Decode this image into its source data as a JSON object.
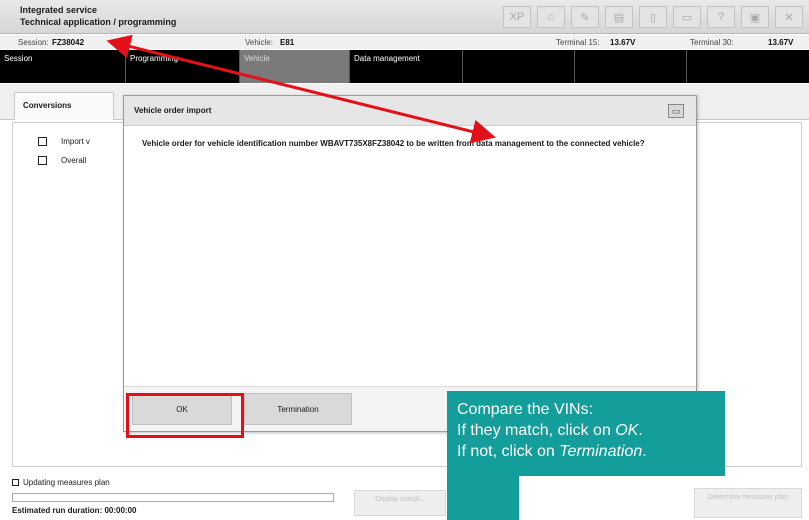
{
  "app": {
    "title_line1": "Integrated service",
    "title_line2": "Technical application / programming",
    "toolbar_icons": [
      "xp-icon",
      "home-icon",
      "wrench-icon",
      "id-card-icon",
      "document-icon",
      "print-icon",
      "help-icon",
      "display-icon",
      "close-icon"
    ],
    "toolbar_glyphs": [
      "XP",
      "⌂",
      "✎",
      "▤",
      "▯",
      "▭",
      "?",
      "▣",
      "✕"
    ]
  },
  "info": {
    "session_label": "Session:",
    "session_value": "FZ38042",
    "vehicle_label": "Vehicle:",
    "vehicle_value": "E81",
    "terminal15_label": "Terminal 15:",
    "terminal15_value": "13.67V",
    "terminal30_label": "Terminal 30:",
    "terminal30_value": "13.67V"
  },
  "nav": {
    "items": [
      "Session",
      "Programming",
      "Vehicle",
      "Data management",
      "",
      "",
      "",
      ""
    ]
  },
  "subtabs": {
    "conversions": "Conversions"
  },
  "content": {
    "row1": "Import v",
    "row2": "Overall"
  },
  "bottom": {
    "updating": "Updating measures plan",
    "duration_label": "Estimated run duration:",
    "duration_value": "00:00:00",
    "display_button": "Display compl...",
    "determine_button": "Determine measures plan"
  },
  "dialog": {
    "title": "Vehicle order import",
    "message": "Vehicle order for vehicle identification number WBAVT735X8FZ38042 to be written from data management to the connected vehicle?",
    "ok_label": "OK",
    "termination_label": "Termination"
  },
  "callout": {
    "line1": "Compare the VINs:",
    "line2_prefix": "If they match, click on ",
    "line2_emph": "OK",
    "line2_suffix": ".",
    "line3_prefix": "If not, click on ",
    "line3_emph": "Termination",
    "line3_suffix": "."
  },
  "colors": {
    "annotation_red": "#e3101a",
    "callout_teal": "#139e9c",
    "nav_black": "#000000"
  }
}
